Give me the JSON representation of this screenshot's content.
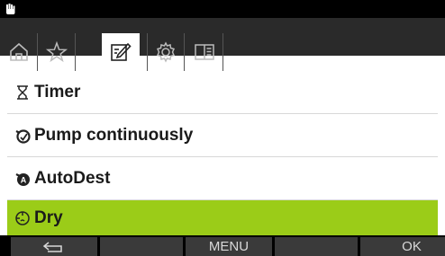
{
  "header": {
    "status_icon": "hand-icon",
    "tabs": [
      {
        "name": "home",
        "icon": "home-icon",
        "active": false
      },
      {
        "name": "favorites",
        "icon": "star-icon",
        "active": false
      },
      {
        "name": "edit",
        "icon": "edit-icon",
        "active": true
      },
      {
        "name": "settings",
        "icon": "gear-icon",
        "active": false
      },
      {
        "name": "manual",
        "icon": "book-icon",
        "active": false
      }
    ]
  },
  "menu": {
    "items": [
      {
        "label": "Timer",
        "icon": "hourglass-icon",
        "selected": false
      },
      {
        "label": "Pump continuously",
        "icon": "pump-icon",
        "selected": false
      },
      {
        "label": "AutoDest",
        "icon": "pump-auto-icon",
        "selected": false
      },
      {
        "label": "Dry",
        "icon": "dry-icon",
        "selected": true
      }
    ]
  },
  "softkeys": {
    "back_icon": "back-arrow-icon",
    "key2": "",
    "menu": "MENU",
    "key4": "",
    "ok": "OK"
  },
  "colors": {
    "selected_row": "#9bcc18",
    "topbar": "#2a2a2a",
    "softkey_bg": "#3a3a3a"
  }
}
